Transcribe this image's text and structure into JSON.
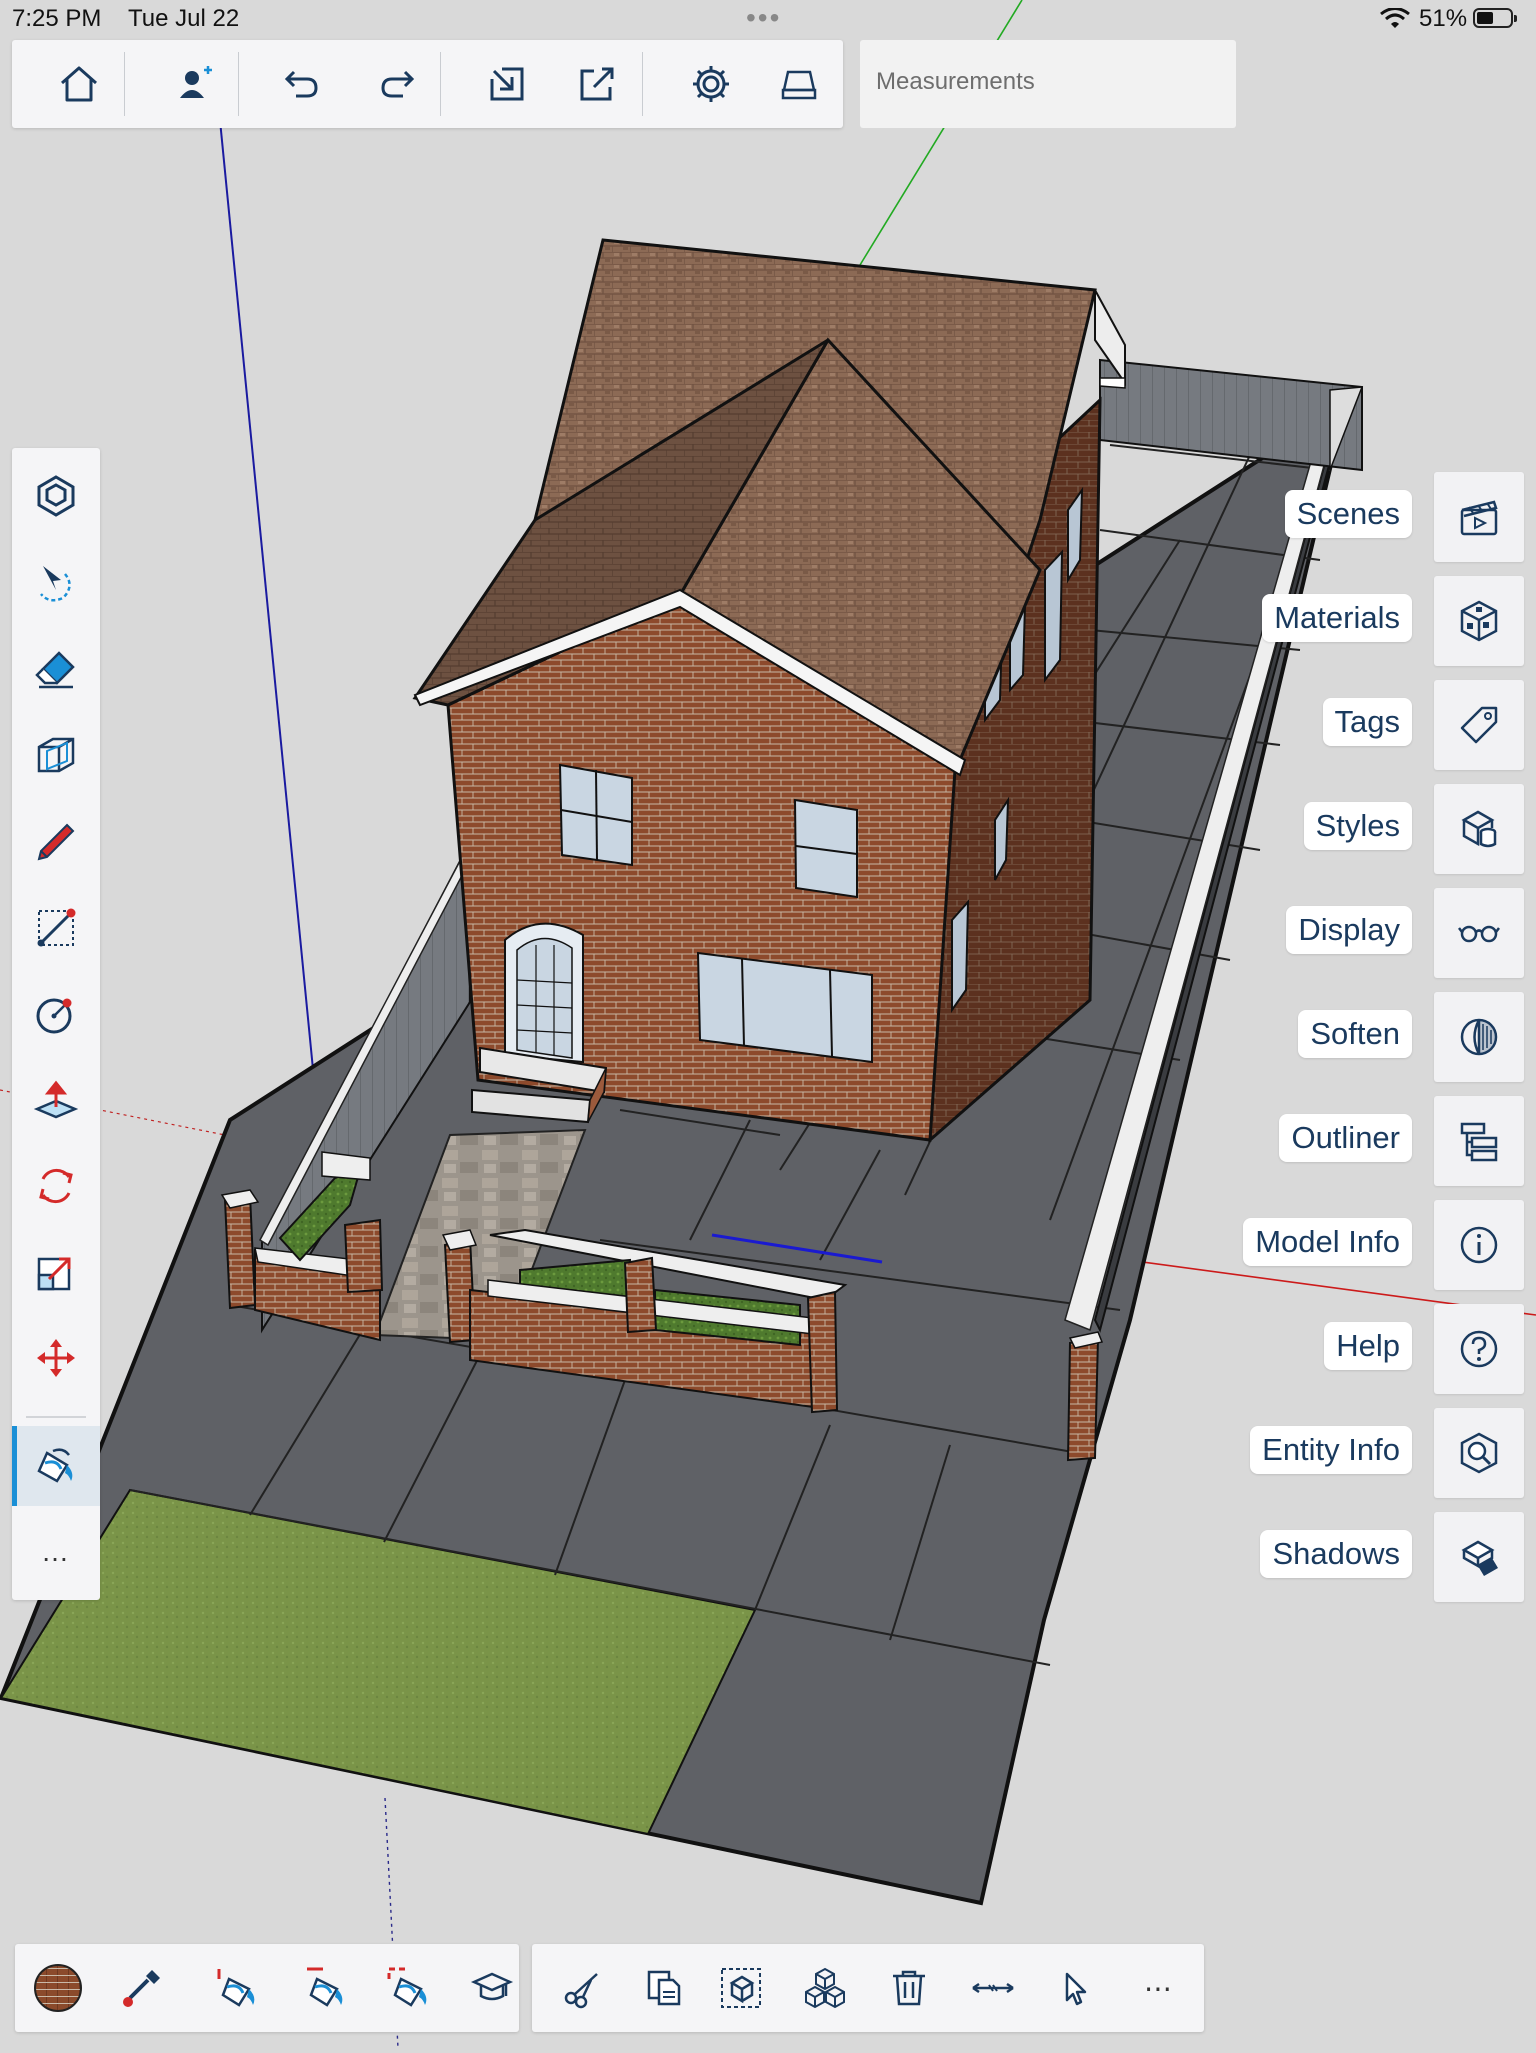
{
  "status_bar": {
    "time": "7:25 PM",
    "date": "Tue Jul 22",
    "dots": "•••",
    "battery": "51%",
    "battery_level": 0.51
  },
  "top_toolbar": {
    "buttons": [
      {
        "icon": "home-icon"
      },
      {
        "icon": "add-user-icon"
      },
      {
        "icon": "undo-icon"
      },
      {
        "icon": "redo-icon"
      },
      {
        "icon": "import-icon"
      },
      {
        "icon": "export-icon"
      },
      {
        "icon": "settings-gear-icon"
      },
      {
        "icon": "drive-icon"
      }
    ],
    "measurements_placeholder": "Measurements"
  },
  "left_toolbar": {
    "tools": [
      {
        "name": "orbit",
        "icon": "orbit-icon"
      },
      {
        "name": "select",
        "icon": "lasso-select-icon"
      },
      {
        "name": "eraser",
        "icon": "eraser-icon"
      },
      {
        "name": "section",
        "icon": "section-plane-icon"
      },
      {
        "name": "pencil",
        "icon": "pencil-icon"
      },
      {
        "name": "line",
        "icon": "line-tool-icon"
      },
      {
        "name": "circle",
        "icon": "circle-tool-icon"
      },
      {
        "name": "push-pull",
        "icon": "push-pull-icon"
      },
      {
        "name": "rotate",
        "icon": "rotate-icon"
      },
      {
        "name": "scale",
        "icon": "scale-icon"
      },
      {
        "name": "move",
        "icon": "move-icon"
      },
      {
        "name": "paint",
        "icon": "paint-bucket-icon",
        "active": true
      }
    ],
    "more_label": "…"
  },
  "right_panels": [
    {
      "label": "Scenes",
      "icon": "clapperboard-icon"
    },
    {
      "label": "Materials",
      "icon": "materials-cube-icon"
    },
    {
      "label": "Tags",
      "icon": "tag-icon"
    },
    {
      "label": "Styles",
      "icon": "styles-cubes-icon"
    },
    {
      "label": "Display",
      "icon": "glasses-icon"
    },
    {
      "label": "Soften",
      "icon": "soften-sphere-icon"
    },
    {
      "label": "Outliner",
      "icon": "outliner-tree-icon"
    },
    {
      "label": "Model Info",
      "icon": "info-icon"
    },
    {
      "label": "Help",
      "icon": "help-icon"
    },
    {
      "label": "Entity Info",
      "icon": "entity-info-icon"
    },
    {
      "label": "Shadows",
      "icon": "shadows-icon"
    }
  ],
  "bottom_toolbar_left": {
    "current_material": "brick",
    "buttons": [
      {
        "icon": "material-swatch-icon"
      },
      {
        "icon": "eyedropper-icon"
      },
      {
        "icon": "paint-adjacent-icon"
      },
      {
        "icon": "paint-connected-icon"
      },
      {
        "icon": "paint-all-matching-icon"
      },
      {
        "icon": "instructor-cap-icon"
      }
    ]
  },
  "bottom_toolbar_right": {
    "buttons": [
      {
        "icon": "cut-icon"
      },
      {
        "icon": "copy-icon"
      },
      {
        "icon": "select-group-icon"
      },
      {
        "icon": "components-icon"
      },
      {
        "icon": "delete-icon"
      },
      {
        "icon": "dimension-icon"
      },
      {
        "icon": "cursor-icon"
      }
    ],
    "more_label": "⋯"
  },
  "colors": {
    "accent": "#1a8fd6",
    "panel_text": "#1a3a5e",
    "toolbar_bg": "#f5f5f7",
    "viewport_bg": "#d9d9d9"
  }
}
